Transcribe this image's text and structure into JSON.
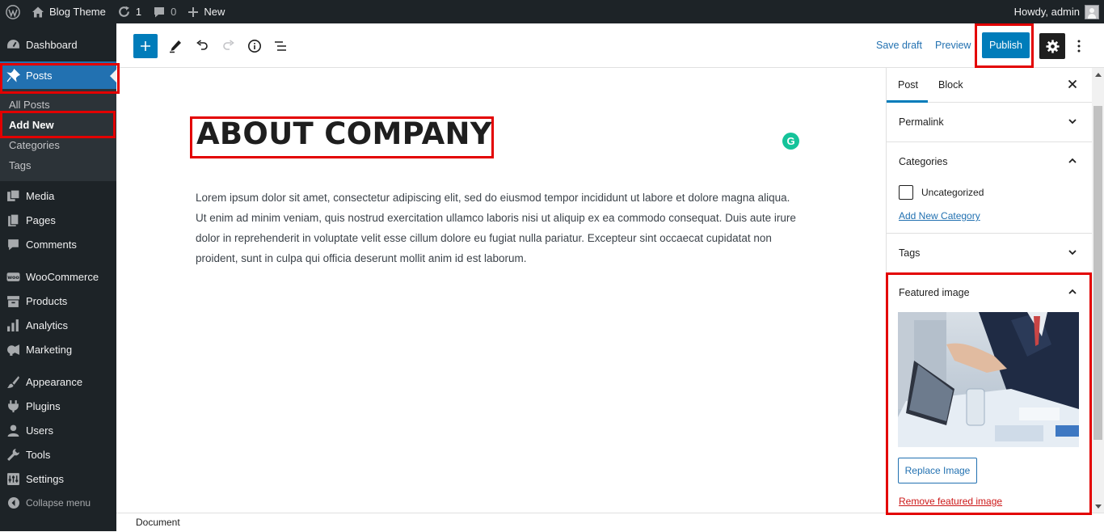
{
  "adminbar": {
    "site_name": "Blog Theme",
    "updates_count": "1",
    "comments_count": "0",
    "new_label": "New",
    "howdy": "Howdy, admin"
  },
  "sidebar": {
    "dashboard": "Dashboard",
    "posts": "Posts",
    "posts_submenu": [
      "All Posts",
      "Add New",
      "Categories",
      "Tags"
    ],
    "media": "Media",
    "pages": "Pages",
    "comments": "Comments",
    "woocommerce": "WooCommerce",
    "products": "Products",
    "analytics": "Analytics",
    "marketing": "Marketing",
    "appearance": "Appearance",
    "plugins": "Plugins",
    "users": "Users",
    "tools": "Tools",
    "settings": "Settings",
    "collapse": "Collapse menu"
  },
  "header": {
    "save_draft": "Save draft",
    "preview": "Preview",
    "publish": "Publish"
  },
  "post": {
    "title": "ABOUT COMPANY",
    "body": "Lorem ipsum dolor sit amet, consectetur adipiscing elit, sed do eiusmod tempor incididunt ut labore et dolore magna aliqua. Ut enim ad minim veniam, quis nostrud exercitation ullamco laboris nisi ut aliquip ex ea commodo consequat. Duis aute irure dolor in reprehenderit in voluptate velit esse cillum dolore eu fugiat nulla pariatur. Excepteur sint occaecat cupidatat non proident, sunt in culpa qui officia deserunt mollit anim id est laborum."
  },
  "panel": {
    "tab_post": "Post",
    "tab_block": "Block",
    "permalink": "Permalink",
    "categories": "Categories",
    "uncategorized": "Uncategorized",
    "add_new_category": "Add New Category",
    "tags": "Tags",
    "featured_image": "Featured image",
    "replace_image": "Replace Image",
    "remove_featured_image": "Remove featured image"
  },
  "footer": {
    "breadcrumb": "Document"
  },
  "colors": {
    "admin_dark": "#1d2327",
    "accent": "#007cba",
    "highlight_box": "#e30000"
  }
}
